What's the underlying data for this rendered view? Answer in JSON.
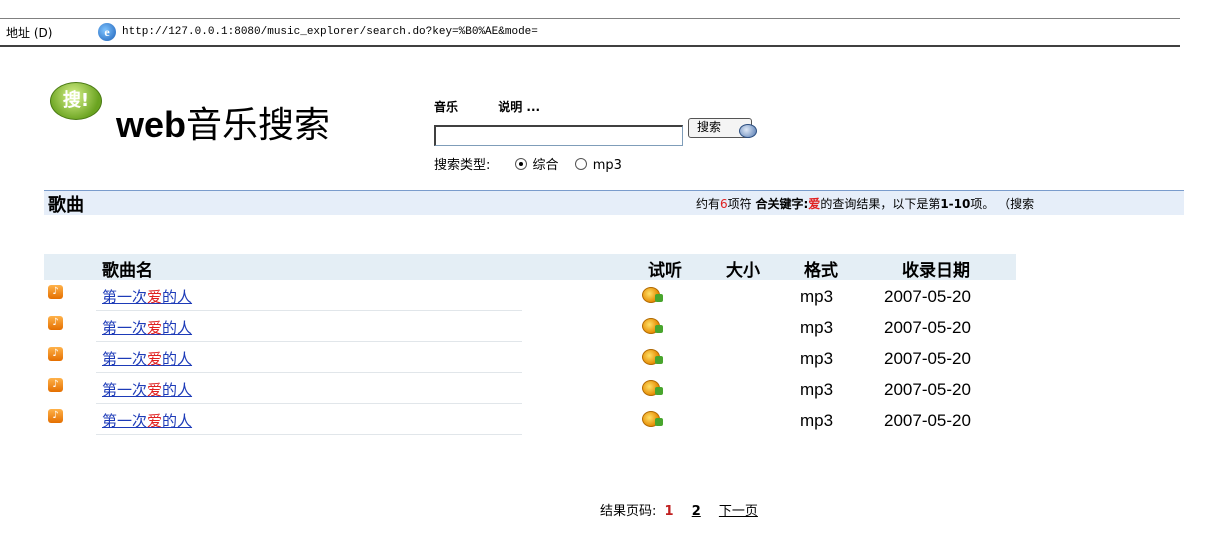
{
  "address_bar": {
    "label": "地址 (D)",
    "url": "http://127.0.0.1:8080/music_explorer/search.do?key=%B0%AE&mode="
  },
  "logo": {
    "icon_text": "搜!",
    "web": "web",
    "title": "音乐搜索"
  },
  "search": {
    "tabs": [
      "音乐",
      "说明 ..."
    ],
    "input_value": "",
    "button_label": "搜索",
    "type_label": "搜索类型:",
    "options": [
      "综合",
      "mp3"
    ],
    "selected": "综合"
  },
  "section": {
    "title": "歌曲",
    "summary_prefix": "约有",
    "summary_count": "6",
    "summary_mid": "项符 ",
    "summary_keyword_label": "合关键字:",
    "summary_keyword": "爱",
    "summary_suffix_1": "的查询结果，以下是第",
    "summary_range": "1-10",
    "summary_suffix_2": "项。  （搜索"
  },
  "table": {
    "headers": {
      "name": "歌曲名",
      "listen": "试听",
      "size": "大小",
      "format": "格式",
      "date": "收录日期"
    },
    "rows": [
      {
        "title_pre": "第一次",
        "title_hl": "爱",
        "title_post": "的人",
        "size": "",
        "format": "mp3",
        "date": "2007-05-20"
      },
      {
        "title_pre": "第一次",
        "title_hl": "爱",
        "title_post": "的人",
        "size": "",
        "format": "mp3",
        "date": "2007-05-20"
      },
      {
        "title_pre": "第一次",
        "title_hl": "爱",
        "title_post": "的人",
        "size": "",
        "format": "mp3",
        "date": "2007-05-20"
      },
      {
        "title_pre": "第一次",
        "title_hl": "爱",
        "title_post": "的人",
        "size": "",
        "format": "mp3",
        "date": "2007-05-20"
      },
      {
        "title_pre": "第一次",
        "title_hl": "爱",
        "title_post": "的人",
        "size": "",
        "format": "mp3",
        "date": "2007-05-20"
      }
    ]
  },
  "pager": {
    "label": "结果页码:",
    "current": "1",
    "page2": "2",
    "next": "下一页"
  },
  "colors": {
    "highlight": "#e02020",
    "link": "#1d3bb8",
    "section_bg": "#e6eef9"
  }
}
